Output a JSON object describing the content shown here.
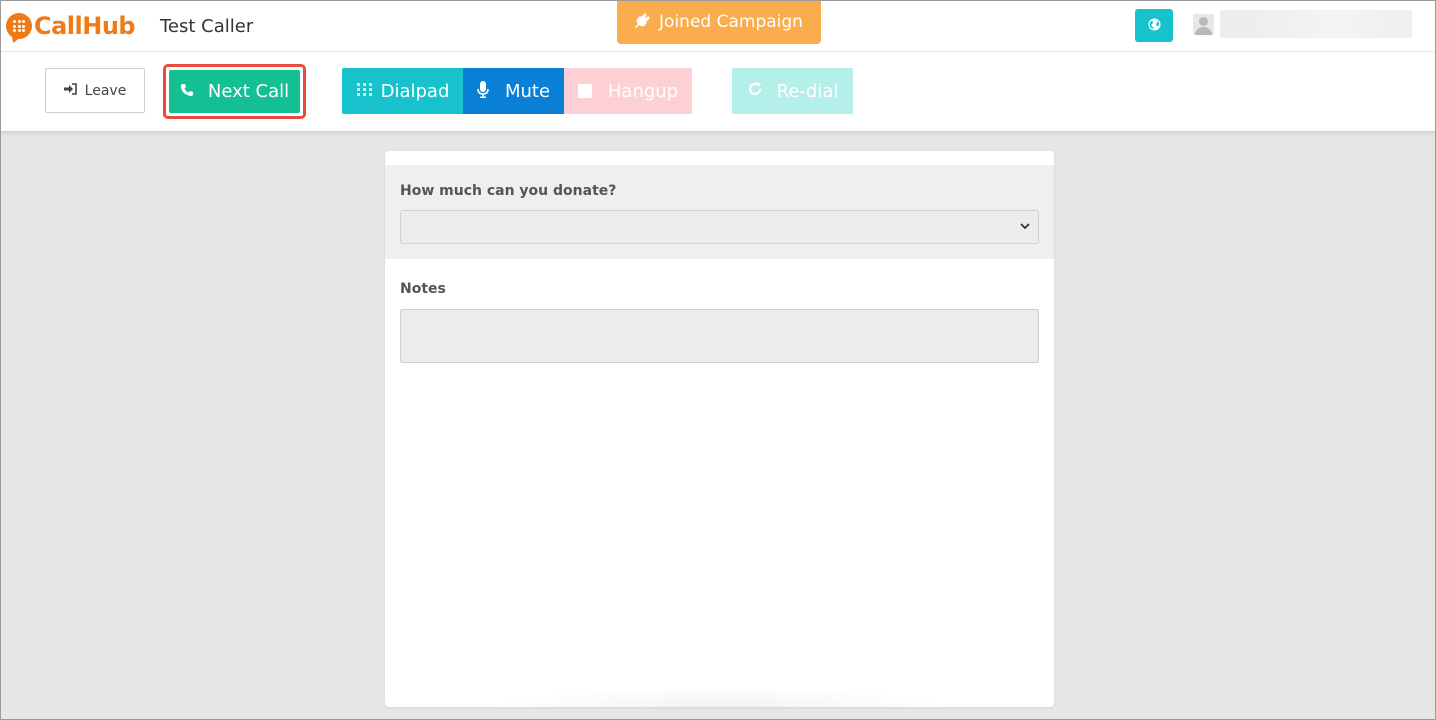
{
  "header": {
    "logo_text": "CallHub",
    "caller_name": "Test Caller",
    "campaign_status": "Joined Campaign",
    "status_color": "#fbad4d",
    "globe_icon": "globe-icon",
    "avatar_icon": "user-avatar-icon"
  },
  "toolbar": {
    "leave_label": "Leave",
    "next_call_label": "Next Call",
    "dialpad_label": "Dialpad",
    "mute_label": "Mute",
    "hangup_label": "Hangup",
    "redial_label": "Re-dial",
    "colors": {
      "next_call": "#14bf93",
      "dialpad": "#17c2cd",
      "mute": "#0a7fd6",
      "hangup": "#fdd0d6",
      "redial": "#b4efe9",
      "highlight": "#e74c3c"
    }
  },
  "form": {
    "donate_question": "How much can you donate?",
    "donate_selected": "",
    "notes_label": "Notes",
    "notes_value": ""
  }
}
